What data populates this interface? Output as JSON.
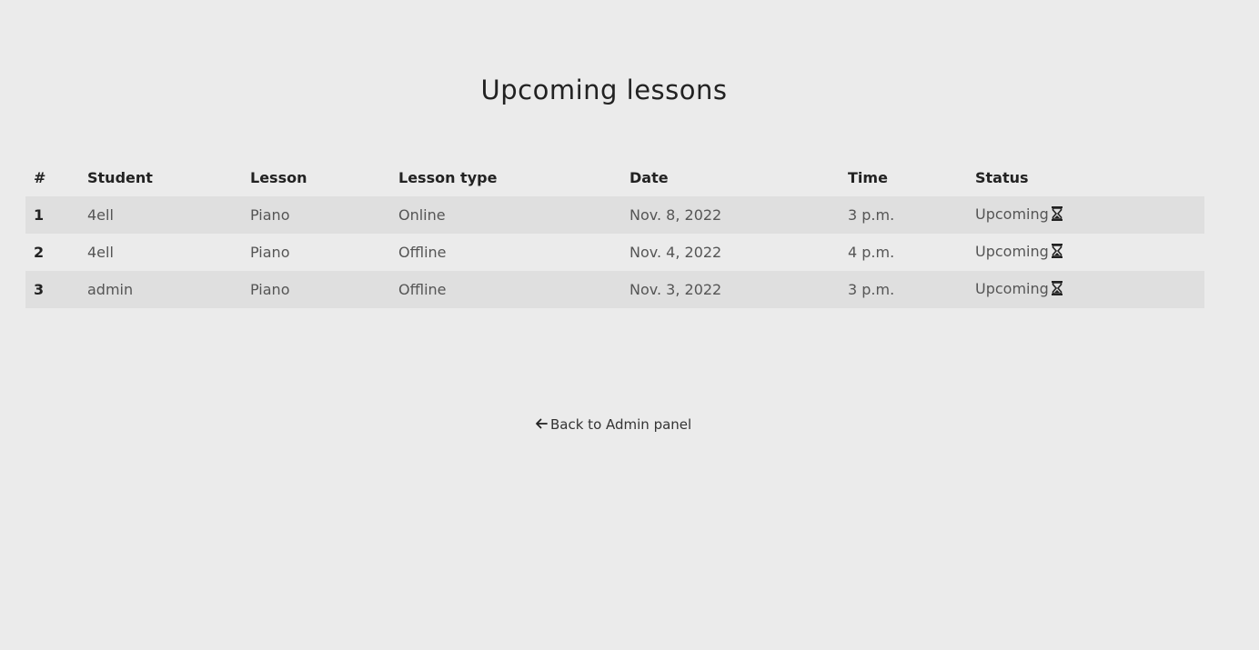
{
  "page": {
    "title": "Upcoming lessons",
    "back_link": "Back to Admin panel"
  },
  "table": {
    "headers": [
      "#",
      "Student",
      "Lesson",
      "Lesson type",
      "Date",
      "Time",
      "Status"
    ],
    "rows": [
      {
        "num": "1",
        "student": "4ell",
        "lesson": "Piano",
        "type": "Online",
        "date": "Nov. 8, 2022",
        "time": "3 p.m.",
        "status": "Upcoming"
      },
      {
        "num": "2",
        "student": "4ell",
        "lesson": "Piano",
        "type": "Offline",
        "date": "Nov. 4, 2022",
        "time": "4 p.m.",
        "status": "Upcoming"
      },
      {
        "num": "3",
        "student": "admin",
        "lesson": "Piano",
        "type": "Offline",
        "date": "Nov. 3, 2022",
        "time": "3 p.m.",
        "status": "Upcoming"
      }
    ]
  },
  "icons": {
    "status": "hourglass-icon",
    "back": "arrow-left-icon"
  },
  "colors": {
    "background": "#ebebeb",
    "row_stripe": "#dfdfdf"
  }
}
